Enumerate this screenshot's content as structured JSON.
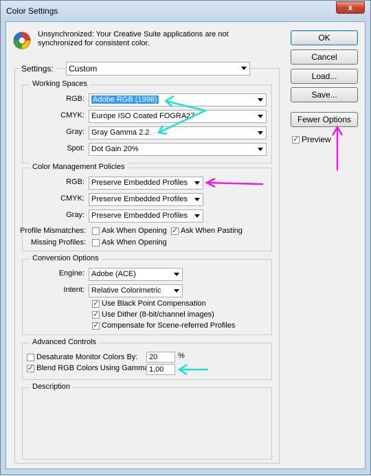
{
  "window": {
    "title": "Color Settings",
    "close_label": "x"
  },
  "message": "Unsynchronized: Your Creative Suite applications are not synchronized for consistent color.",
  "buttons": {
    "ok": "OK",
    "cancel": "Cancel",
    "load": "Load...",
    "save": "Save...",
    "fewer_options": "Fewer Options"
  },
  "preview": {
    "label": "Preview",
    "checked": true
  },
  "settings": {
    "label": "Settings:",
    "value": "Custom"
  },
  "working_spaces": {
    "title": "Working Spaces",
    "rgb": {
      "label": "RGB:",
      "value": "Adobe RGB (1998)"
    },
    "cmyk": {
      "label": "CMYK:",
      "value": "Europe ISO Coated FOGRA27"
    },
    "gray": {
      "label": "Gray:",
      "value": "Gray Gamma 2.2"
    },
    "spot": {
      "label": "Spot:",
      "value": "Dot Gain 20%"
    }
  },
  "policies": {
    "title": "Color Management Policies",
    "rgb": {
      "label": "RGB:",
      "value": "Preserve Embedded Profiles"
    },
    "cmyk": {
      "label": "CMYK:",
      "value": "Preserve Embedded Profiles"
    },
    "gray": {
      "label": "Gray:",
      "value": "Preserve Embedded Profiles"
    },
    "profile_mismatches": {
      "label": "Profile Mismatches:",
      "ask_opening": "Ask When Opening",
      "ask_opening_checked": false,
      "ask_pasting": "Ask When Pasting",
      "ask_pasting_checked": true
    },
    "missing_profiles": {
      "label": "Missing Profiles:",
      "ask_opening": "Ask When Opening",
      "ask_opening_checked": false
    }
  },
  "conversion": {
    "title": "Conversion Options",
    "engine": {
      "label": "Engine:",
      "value": "Adobe (ACE)"
    },
    "intent": {
      "label": "Intent:",
      "value": "Relative Colorimetric"
    },
    "black_point": {
      "label": "Use Black Point Compensation",
      "checked": true
    },
    "dither": {
      "label": "Use Dither (8-bit/channel images)",
      "checked": true
    },
    "scene_referred": {
      "label": "Compensate for Scene-referred Profiles",
      "checked": true
    }
  },
  "advanced": {
    "title": "Advanced Controls",
    "desaturate": {
      "label": "Desaturate Monitor Colors By:",
      "checked": false,
      "value": "20",
      "unit": "%"
    },
    "blend": {
      "label": "Blend RGB Colors Using Gamma:",
      "checked": true,
      "value": "1,00"
    }
  },
  "description": {
    "title": "Description"
  },
  "colors": {
    "arrow_cyan": "#19e3d0",
    "arrow_magenta": "#e81ee0",
    "selection": "#3399ff"
  }
}
